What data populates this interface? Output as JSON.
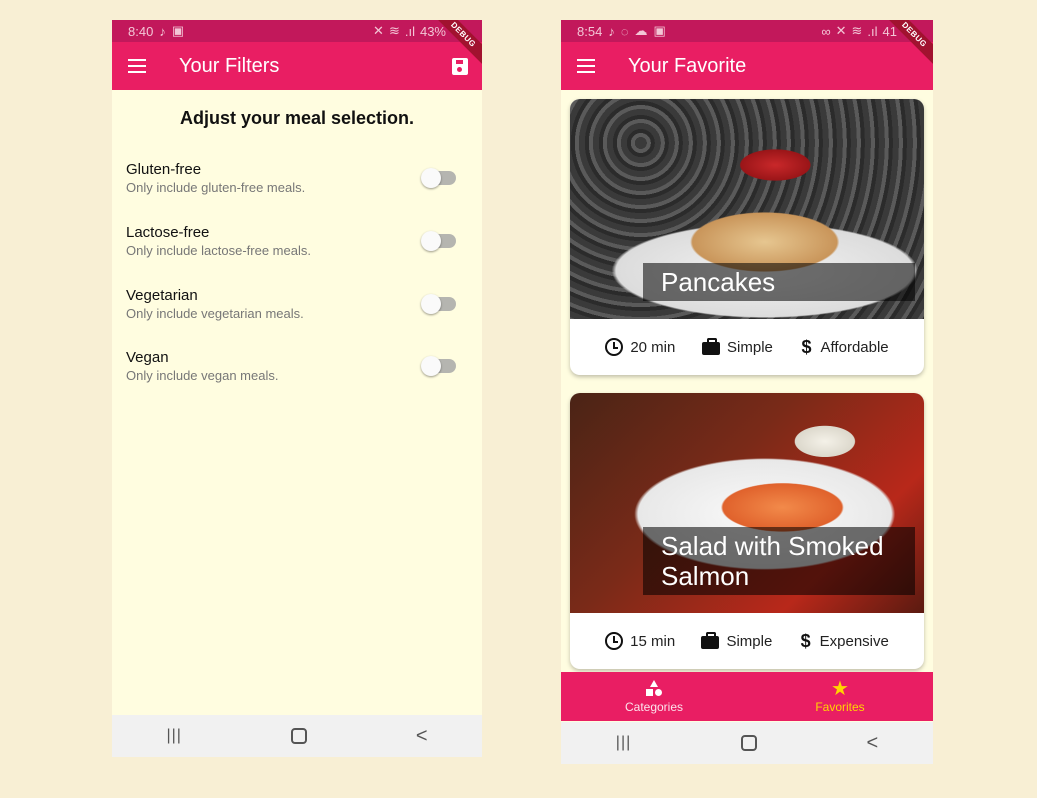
{
  "filters_screen": {
    "status": {
      "time": "8:40",
      "battery": "43%"
    },
    "debug_banner": "DEBUG",
    "appbar": {
      "title": "Your Filters"
    },
    "heading": "Adjust your meal selection.",
    "filters": [
      {
        "title": "Gluten-free",
        "subtitle": "Only include gluten-free meals.",
        "enabled": false
      },
      {
        "title": "Lactose-free",
        "subtitle": "Only include lactose-free meals.",
        "enabled": false
      },
      {
        "title": "Vegetarian",
        "subtitle": "Only include vegetarian meals.",
        "enabled": false
      },
      {
        "title": "Vegan",
        "subtitle": "Only include vegan meals.",
        "enabled": false
      }
    ],
    "nav": {
      "recents": "|||",
      "back": "<"
    }
  },
  "favorites_screen": {
    "status": {
      "time": "8:54",
      "battery": "41"
    },
    "debug_banner": "DEBUG",
    "appbar": {
      "title": "Your Favorite"
    },
    "meals": [
      {
        "title": "Pancakes",
        "duration": "20 min",
        "complexity": "Simple",
        "affordability": "Affordable"
      },
      {
        "title": "Salad with Smoked Salmon",
        "duration": "15 min",
        "complexity": "Simple",
        "affordability": "Expensive"
      }
    ],
    "tabs": [
      {
        "label": "Categories",
        "icon": "category-icon",
        "selected": false
      },
      {
        "label": "Favorites",
        "icon": "star-icon",
        "selected": true
      }
    ],
    "nav": {
      "recents": "|||",
      "back": "<"
    }
  },
  "colors": {
    "primary": "#e91e63",
    "status_bar": "#c2185b",
    "background": "#fffde0",
    "accent": "#ffd600"
  }
}
